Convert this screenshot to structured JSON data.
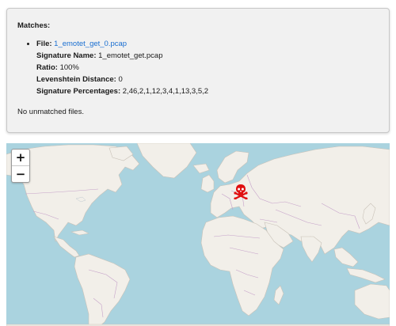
{
  "matches": {
    "title": "Matches:",
    "items": [
      {
        "file_label": "File:",
        "file_value": "1_emotet_get_0.pcap",
        "signature_name_label": "Signature Name:",
        "signature_name_value": "1_emotet_get.pcap",
        "ratio_label": "Ratio:",
        "ratio_value": "100%",
        "levenshtein_label": "Levenshtein Distance:",
        "levenshtein_value": "0",
        "percentages_label": "Signature Percentages:",
        "percentages_value": "2,46,2,1,12,3,4,1,13,3,5,2"
      }
    ],
    "unmatched_text": "No unmatched files."
  },
  "map": {
    "zoom_in_label": "+",
    "zoom_out_label": "−",
    "marker_icon": "skull-crossbones-icon",
    "colors": {
      "water": "#aad3df",
      "land": "#f2efe9",
      "border": "#c5a1c9",
      "marker": "#e01010"
    }
  }
}
